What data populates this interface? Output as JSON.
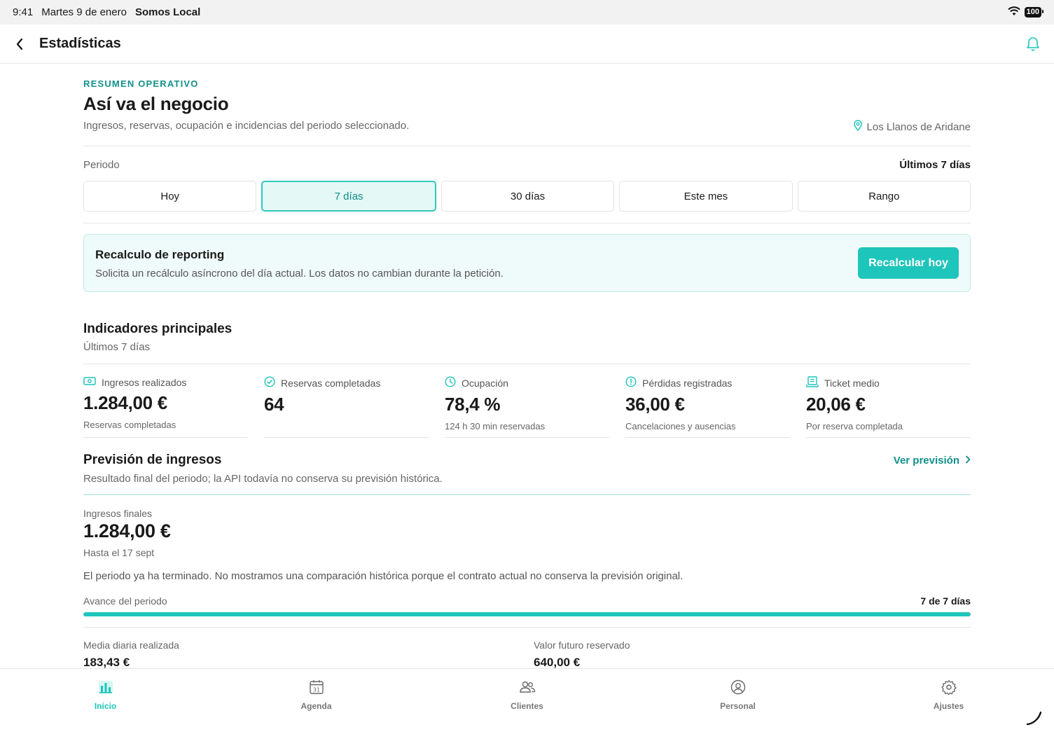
{
  "status_bar": {
    "time": "9:41",
    "date": "Martes 9 de enero",
    "app_name": "Somos Local",
    "battery": "100"
  },
  "nav": {
    "title": "Estadísticas",
    "back_icon": "chevron-left-icon",
    "bell_icon": "bell-icon"
  },
  "header": {
    "eyebrow": "RESUMEN OPERATIVO",
    "title": "Así va el negocio",
    "subtitle": "Ingresos, reservas, ocupación e incidencias del periodo seleccionado.",
    "location": "Los Llanos de Aridane"
  },
  "period": {
    "label": "Periodo",
    "current": "Últimos 7 días",
    "tabs": [
      {
        "label": "Hoy"
      },
      {
        "label": "7 días",
        "active": true
      },
      {
        "label": "30 días"
      },
      {
        "label": "Este mes"
      },
      {
        "label": "Rango"
      }
    ]
  },
  "recalc": {
    "title": "Recalculo de reporting",
    "description": "Solicita un recálculo asíncrono del día actual. Los datos no cambian durante la petición.",
    "button": "Recalcular hoy"
  },
  "kpi_section": {
    "title": "Indicadores principales",
    "subtitle": "Últimos 7 días",
    "items": [
      {
        "icon": "money-icon",
        "label": "Ingresos realizados",
        "value": "1.284,00 €",
        "note": "Reservas completadas"
      },
      {
        "icon": "check-circle-icon",
        "label": "Reservas completadas",
        "value": "64",
        "note": ""
      },
      {
        "icon": "clock-icon",
        "label": "Ocupación",
        "value": "78,4 %",
        "note": "124 h 30 min reservadas"
      },
      {
        "icon": "alert-circle-icon",
        "label": "Pérdidas registradas",
        "value": "36,00 €",
        "note": "Cancelaciones y ausencias"
      },
      {
        "icon": "receipt-icon",
        "label": "Ticket medio",
        "value": "20,06 €",
        "note": "Por reserva completada"
      }
    ]
  },
  "forecast": {
    "title": "Previsión de ingresos",
    "subtitle": "Resultado final del periodo; la API todavía no conserva su previsión histórica.",
    "link": "Ver previsión",
    "final_label": "Ingresos finales",
    "final_value": "1.284,00 €",
    "final_note": "Hasta el 17 sept",
    "description": "El periodo ya ha terminado. No mostramos una comparación histórica porque el contrato actual no conserva la previsión original.",
    "progress_label": "Avance del periodo",
    "progress_count": "7 de 7 días",
    "progress_fraction": 1.0,
    "daily_label": "Media diaria realizada",
    "daily_value": "183,43 €",
    "future_label": "Valor futuro reservado",
    "future_value": "640,00 €"
  },
  "tabbar": {
    "items": [
      {
        "label": "Inicio",
        "icon": "bar-chart-icon",
        "active": true
      },
      {
        "label": "Agenda",
        "icon": "calendar-icon"
      },
      {
        "label": "Clientes",
        "icon": "users-icon"
      },
      {
        "label": "Personal",
        "icon": "user-circle-icon"
      },
      {
        "label": "Ajustes",
        "icon": "gear-icon"
      }
    ]
  },
  "colors": {
    "accent": "#1ec5bb",
    "accent_dark": "#11908a",
    "muted_text": "#666666"
  }
}
